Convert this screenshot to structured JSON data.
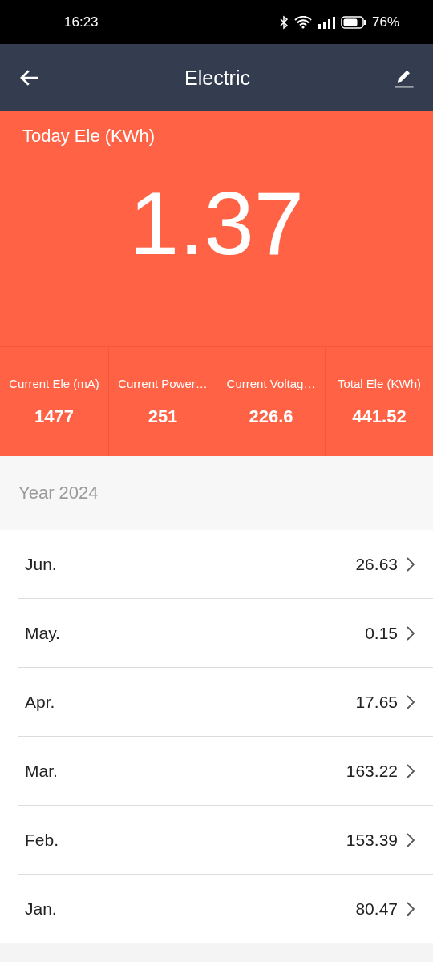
{
  "status_bar": {
    "time": "16:23",
    "battery": "76%"
  },
  "header": {
    "title": "Electric"
  },
  "today": {
    "label": "Today Ele (KWh)",
    "value": "1.37"
  },
  "stats": [
    {
      "label": "Current Ele (mA)",
      "value": "1477"
    },
    {
      "label": "Current Power…",
      "value": "251"
    },
    {
      "label": "Current Voltag…",
      "value": "226.6"
    },
    {
      "label": "Total Ele (KWh)",
      "value": "441.52"
    }
  ],
  "year": {
    "label": "Year 2024"
  },
  "months": [
    {
      "name": "Jun.",
      "value": "26.63"
    },
    {
      "name": "May.",
      "value": "0.15"
    },
    {
      "name": "Apr.",
      "value": "17.65"
    },
    {
      "name": "Mar.",
      "value": "163.22"
    },
    {
      "name": "Feb.",
      "value": "153.39"
    },
    {
      "name": "Jan.",
      "value": "80.47"
    }
  ]
}
